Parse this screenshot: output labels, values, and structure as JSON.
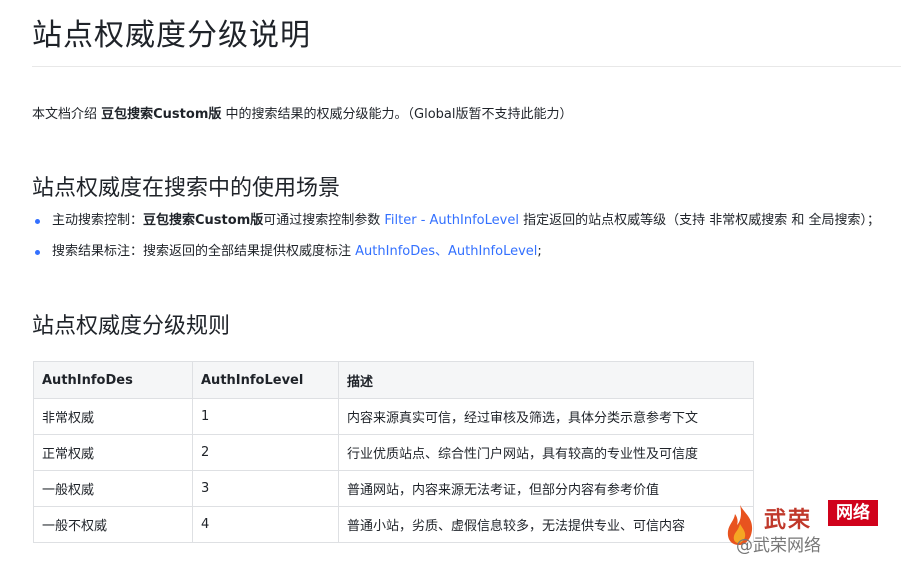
{
  "title": "站点权威度分级说明",
  "intro": {
    "prefix": "本文档介绍 ",
    "product": "豆包搜索Custom版",
    "suffix": " 中的搜索结果的权威分级能力。（Global版暂不支持此能力）"
  },
  "section1": {
    "heading": "站点权威度在搜索中的使用场景",
    "bullets": [
      {
        "label": "主动搜索控制：",
        "bold": "豆包搜索Custom版",
        "text1": "可通过搜索控制参数 ",
        "link": "Filter - AuthInfoLevel",
        "text2": " 指定返回的站点权威等级（支持 非常权威搜索 和 全局搜索）；"
      },
      {
        "label": "搜索结果标注：",
        "text1": "搜索返回的全部结果提供权威度标注 ",
        "link": "AuthInfoDes、AuthInfoLevel",
        "text2": ";"
      }
    ]
  },
  "section2": {
    "heading": "站点权威度分级规则",
    "columns": [
      "AuthInfoDes",
      "AuthInfoLevel",
      "描述"
    ],
    "rows": [
      [
        "非常权威",
        "1",
        "内容来源真实可信，经过审核及筛选，具体分类示意参考下文"
      ],
      [
        "正常权威",
        "2",
        "行业优质站点、综合性门户网站，具有较高的专业性及可信度"
      ],
      [
        "一般权威",
        "3",
        "普通网站，内容来源无法考证，但部分内容有参考价值"
      ],
      [
        "一般不权威",
        "4",
        "普通小站，劣质、虚假信息较多，无法提供专业、可信内容"
      ]
    ]
  },
  "watermark": {
    "brand_left": "武荣",
    "brand_right": "网络",
    "handle": "@武荣网络",
    "colors": {
      "brand": "#c0392b",
      "box": "#d0021b",
      "flame": "#e8531f"
    }
  }
}
